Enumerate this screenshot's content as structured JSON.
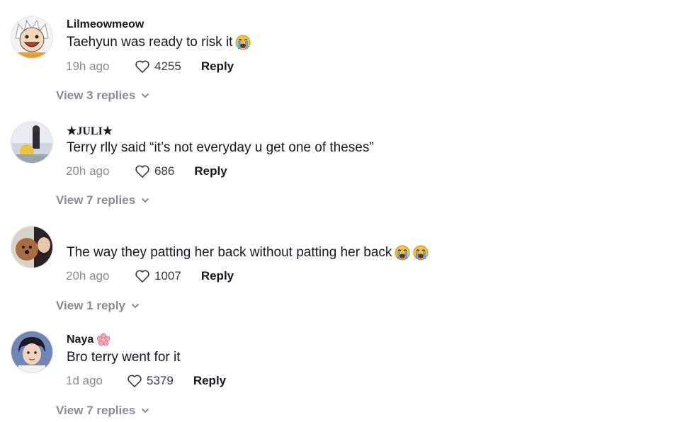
{
  "comments": [
    {
      "username": "Lilmeowmeow",
      "text": "Taehyun was ready to risk it",
      "time": "19h ago",
      "likes": "4255",
      "reply_label": "Reply",
      "view_replies": "View 3 replies",
      "avatar_icon": "anime-character-avatar"
    },
    {
      "username": "★JULI★",
      "text": "Terry rlly said “it’s not everyday u get one of theses”",
      "time": "20h ago",
      "likes": "686",
      "reply_label": "Reply",
      "view_replies": "View 7 replies",
      "avatar_icon": "photo-avatar"
    },
    {
      "username": "",
      "text": "The way they patting her back without patting her back",
      "time": "20h ago",
      "likes": "1007",
      "reply_label": "Reply",
      "view_replies": "View 1 reply",
      "avatar_icon": "girl-with-dog-avatar"
    },
    {
      "username": "Naya",
      "text": "Bro terry went for it",
      "time": "1d ago",
      "likes": "5379",
      "reply_label": "Reply",
      "view_replies": "View 7 replies",
      "avatar_icon": "person-avatar"
    }
  ],
  "colors": {
    "primary_text": "#161823",
    "secondary_text": "#8a8b91",
    "emoji_face": "#f7c33b",
    "flower": "#f2a3c4"
  }
}
